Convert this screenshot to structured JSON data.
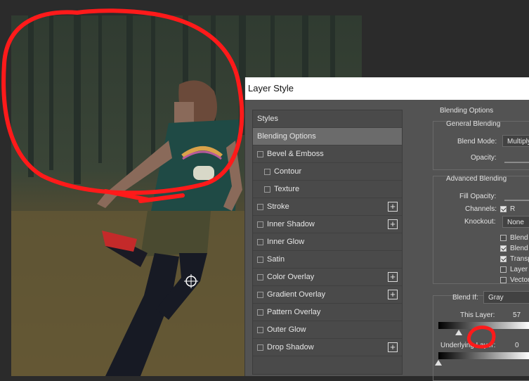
{
  "dialog": {
    "title": "Layer Style"
  },
  "styles_list": [
    {
      "label": "Styles",
      "checkbox": false,
      "plus": false,
      "indent": 0,
      "selected": false
    },
    {
      "label": "Blending Options",
      "checkbox": false,
      "plus": false,
      "indent": 0,
      "selected": true
    },
    {
      "label": "Bevel & Emboss",
      "checkbox": true,
      "plus": false,
      "indent": 0,
      "selected": false
    },
    {
      "label": "Contour",
      "checkbox": true,
      "plus": false,
      "indent": 1,
      "selected": false
    },
    {
      "label": "Texture",
      "checkbox": true,
      "plus": false,
      "indent": 1,
      "selected": false
    },
    {
      "label": "Stroke",
      "checkbox": true,
      "plus": true,
      "indent": 0,
      "selected": false
    },
    {
      "label": "Inner Shadow",
      "checkbox": true,
      "plus": true,
      "indent": 0,
      "selected": false
    },
    {
      "label": "Inner Glow",
      "checkbox": true,
      "plus": false,
      "indent": 0,
      "selected": false
    },
    {
      "label": "Satin",
      "checkbox": true,
      "plus": false,
      "indent": 0,
      "selected": false
    },
    {
      "label": "Color Overlay",
      "checkbox": true,
      "plus": true,
      "indent": 0,
      "selected": false
    },
    {
      "label": "Gradient Overlay",
      "checkbox": true,
      "plus": true,
      "indent": 0,
      "selected": false
    },
    {
      "label": "Pattern Overlay",
      "checkbox": true,
      "plus": false,
      "indent": 0,
      "selected": false
    },
    {
      "label": "Outer Glow",
      "checkbox": true,
      "plus": false,
      "indent": 0,
      "selected": false
    },
    {
      "label": "Drop Shadow",
      "checkbox": true,
      "plus": true,
      "indent": 0,
      "selected": false
    }
  ],
  "blending": {
    "section_title": "Blending Options",
    "general": {
      "title": "General Blending",
      "blend_mode_label": "Blend Mode:",
      "blend_mode_value": "Multiply",
      "opacity_label": "Opacity:"
    },
    "advanced": {
      "title": "Advanced Blending",
      "fill_opacity_label": "Fill Opacity:",
      "channels_label": "Channels:",
      "channel_r": "R",
      "knockout_label": "Knockout:",
      "knockout_value": "None",
      "options": [
        {
          "label": "Blend",
          "checked": false
        },
        {
          "label": "Blend",
          "checked": true
        },
        {
          "label": "Transp",
          "checked": true
        },
        {
          "label": "Layer",
          "checked": false
        },
        {
          "label": "Vector",
          "checked": false
        }
      ]
    },
    "blend_if": {
      "label": "Blend If:",
      "value": "Gray",
      "this_layer_label": "This Layer:",
      "this_layer_value": "57",
      "this_layer_fraction": 0.2235,
      "underlying_label": "Underlying Layer:",
      "underlying_value": "0",
      "underlying_fraction": 0.0
    }
  },
  "colors": {
    "annotation": "#ff1a1a",
    "dialog_bg": "#535353",
    "selected_item": "#6b6b6b"
  }
}
